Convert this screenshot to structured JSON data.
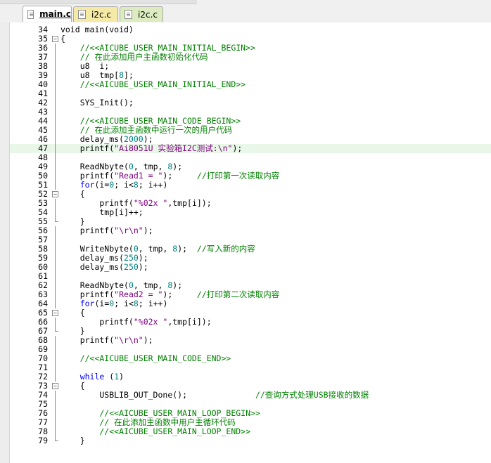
{
  "tabs": [
    {
      "label": "main.c",
      "active": true,
      "color": "#ffffff"
    },
    {
      "label": "i2c.c",
      "active": false,
      "color": "#f5e9a6"
    },
    {
      "label": "i2c.c",
      "active": false,
      "color": "#dcecc0"
    }
  ],
  "editor": {
    "current_line": 47,
    "lines": [
      {
        "n": 34,
        "fold": "none",
        "segs": [
          {
            "t": "void main(void)",
            "c": "fn"
          }
        ]
      },
      {
        "n": 35,
        "fold": "box",
        "segs": [
          {
            "t": "{",
            "c": "fn"
          }
        ]
      },
      {
        "n": 36,
        "fold": "v",
        "segs": [
          {
            "t": "    //<<AICUBE_USER_MAIN_INITIAL_BEGIN>>",
            "c": "com"
          }
        ]
      },
      {
        "n": 37,
        "fold": "v",
        "segs": [
          {
            "t": "    // 在此添加用户主函数初始化代码",
            "c": "com"
          }
        ]
      },
      {
        "n": 38,
        "fold": "v",
        "segs": [
          {
            "t": "    u8  i;",
            "c": "fn"
          }
        ]
      },
      {
        "n": 39,
        "fold": "v",
        "segs": [
          {
            "t": "    u8  tmp[",
            "c": "fn"
          },
          {
            "t": "8",
            "c": "num"
          },
          {
            "t": "];",
            "c": "fn"
          }
        ]
      },
      {
        "n": 40,
        "fold": "v",
        "segs": [
          {
            "t": "    //<<AICUBE_USER_MAIN_INITIAL_END>>",
            "c": "com"
          }
        ]
      },
      {
        "n": 41,
        "fold": "v",
        "segs": []
      },
      {
        "n": 42,
        "fold": "v",
        "segs": [
          {
            "t": "    SYS_Init();",
            "c": "fn"
          }
        ]
      },
      {
        "n": 43,
        "fold": "v",
        "segs": []
      },
      {
        "n": 44,
        "fold": "v",
        "segs": [
          {
            "t": "    //<<AICUBE_USER_MAIN_CODE_BEGIN>>",
            "c": "com"
          }
        ]
      },
      {
        "n": 45,
        "fold": "v",
        "segs": [
          {
            "t": "    // 在此添加主函数中运行一次的用户代码",
            "c": "com"
          }
        ]
      },
      {
        "n": 46,
        "fold": "v",
        "segs": [
          {
            "t": "    delay_ms(",
            "c": "fn"
          },
          {
            "t": "2000",
            "c": "num"
          },
          {
            "t": ");",
            "c": "fn"
          }
        ]
      },
      {
        "n": 47,
        "fold": "v",
        "segs": [
          {
            "t": "    printf(",
            "c": "fn"
          },
          {
            "t": "\"Ai8051U 实验箱I2C测试:\\n\"",
            "c": "str"
          },
          {
            "t": ");",
            "c": "fn"
          }
        ]
      },
      {
        "n": 48,
        "fold": "v",
        "segs": []
      },
      {
        "n": 49,
        "fold": "v",
        "segs": [
          {
            "t": "    ReadNbyte(",
            "c": "fn"
          },
          {
            "t": "0",
            "c": "num"
          },
          {
            "t": ", tmp, ",
            "c": "fn"
          },
          {
            "t": "8",
            "c": "num"
          },
          {
            "t": ");",
            "c": "fn"
          }
        ]
      },
      {
        "n": 50,
        "fold": "v",
        "segs": [
          {
            "t": "    printf(",
            "c": "fn"
          },
          {
            "t": "\"Read1 = \"",
            "c": "str"
          },
          {
            "t": ");     ",
            "c": "fn"
          },
          {
            "t": "//打印第一次读取内容",
            "c": "com"
          }
        ]
      },
      {
        "n": 51,
        "fold": "v",
        "segs": [
          {
            "t": "    ",
            "c": "fn"
          },
          {
            "t": "for",
            "c": "kw"
          },
          {
            "t": "(i=",
            "c": "fn"
          },
          {
            "t": "0",
            "c": "num"
          },
          {
            "t": "; i<",
            "c": "fn"
          },
          {
            "t": "8",
            "c": "num"
          },
          {
            "t": "; i++)",
            "c": "fn"
          }
        ]
      },
      {
        "n": 52,
        "fold": "box",
        "segs": [
          {
            "t": "    {",
            "c": "fn"
          }
        ]
      },
      {
        "n": 53,
        "fold": "v",
        "segs": [
          {
            "t": "        printf(",
            "c": "fn"
          },
          {
            "t": "\"%02x \"",
            "c": "str"
          },
          {
            "t": ",tmp[i]);",
            "c": "fn"
          }
        ]
      },
      {
        "n": 54,
        "fold": "v",
        "segs": [
          {
            "t": "        tmp[i]++;",
            "c": "fn"
          }
        ]
      },
      {
        "n": 55,
        "fold": "end",
        "segs": [
          {
            "t": "    }",
            "c": "fn"
          }
        ]
      },
      {
        "n": 56,
        "fold": "v",
        "segs": [
          {
            "t": "    printf(",
            "c": "fn"
          },
          {
            "t": "\"\\r\\n\"",
            "c": "str"
          },
          {
            "t": ");",
            "c": "fn"
          }
        ]
      },
      {
        "n": 57,
        "fold": "v",
        "segs": []
      },
      {
        "n": 58,
        "fold": "v",
        "segs": [
          {
            "t": "    WriteNbyte(",
            "c": "fn"
          },
          {
            "t": "0",
            "c": "num"
          },
          {
            "t": ", tmp, ",
            "c": "fn"
          },
          {
            "t": "8",
            "c": "num"
          },
          {
            "t": ");  ",
            "c": "fn"
          },
          {
            "t": "//写入新的内容",
            "c": "com"
          }
        ]
      },
      {
        "n": 59,
        "fold": "v",
        "segs": [
          {
            "t": "    delay_ms(",
            "c": "fn"
          },
          {
            "t": "250",
            "c": "num"
          },
          {
            "t": ");",
            "c": "fn"
          }
        ]
      },
      {
        "n": 60,
        "fold": "v",
        "segs": [
          {
            "t": "    delay_ms(",
            "c": "fn"
          },
          {
            "t": "250",
            "c": "num"
          },
          {
            "t": ");",
            "c": "fn"
          }
        ]
      },
      {
        "n": 61,
        "fold": "v",
        "segs": []
      },
      {
        "n": 62,
        "fold": "v",
        "segs": [
          {
            "t": "    ReadNbyte(",
            "c": "fn"
          },
          {
            "t": "0",
            "c": "num"
          },
          {
            "t": ", tmp, ",
            "c": "fn"
          },
          {
            "t": "8",
            "c": "num"
          },
          {
            "t": ");",
            "c": "fn"
          }
        ]
      },
      {
        "n": 63,
        "fold": "v",
        "segs": [
          {
            "t": "    printf(",
            "c": "fn"
          },
          {
            "t": "\"Read2 = \"",
            "c": "str"
          },
          {
            "t": ");     ",
            "c": "fn"
          },
          {
            "t": "//打印第二次读取内容",
            "c": "com"
          }
        ]
      },
      {
        "n": 64,
        "fold": "v",
        "segs": [
          {
            "t": "    ",
            "c": "fn"
          },
          {
            "t": "for",
            "c": "kw"
          },
          {
            "t": "(i=",
            "c": "fn"
          },
          {
            "t": "0",
            "c": "num"
          },
          {
            "t": "; i<",
            "c": "fn"
          },
          {
            "t": "8",
            "c": "num"
          },
          {
            "t": "; i++)",
            "c": "fn"
          }
        ]
      },
      {
        "n": 65,
        "fold": "box",
        "segs": [
          {
            "t": "    {",
            "c": "fn"
          }
        ]
      },
      {
        "n": 66,
        "fold": "v",
        "segs": [
          {
            "t": "        printf(",
            "c": "fn"
          },
          {
            "t": "\"%02x \"",
            "c": "str"
          },
          {
            "t": ",tmp[i]);",
            "c": "fn"
          }
        ]
      },
      {
        "n": 67,
        "fold": "end",
        "segs": [
          {
            "t": "    }",
            "c": "fn"
          }
        ]
      },
      {
        "n": 68,
        "fold": "v",
        "segs": [
          {
            "t": "    printf(",
            "c": "fn"
          },
          {
            "t": "\"\\r\\n\"",
            "c": "str"
          },
          {
            "t": ");",
            "c": "fn"
          }
        ]
      },
      {
        "n": 69,
        "fold": "v",
        "segs": []
      },
      {
        "n": 70,
        "fold": "v",
        "segs": [
          {
            "t": "    //<<AICUBE_USER_MAIN_CODE_END>>",
            "c": "com"
          }
        ]
      },
      {
        "n": 71,
        "fold": "v",
        "segs": []
      },
      {
        "n": 72,
        "fold": "v",
        "segs": [
          {
            "t": "    ",
            "c": "fn"
          },
          {
            "t": "while",
            "c": "kw"
          },
          {
            "t": " (",
            "c": "fn"
          },
          {
            "t": "1",
            "c": "num"
          },
          {
            "t": ")",
            "c": "fn"
          }
        ]
      },
      {
        "n": 73,
        "fold": "box",
        "segs": [
          {
            "t": "    {",
            "c": "fn"
          }
        ]
      },
      {
        "n": 74,
        "fold": "v",
        "segs": [
          {
            "t": "        USBLIB_OUT_Done();              ",
            "c": "fn"
          },
          {
            "t": "//查询方式处理USB接收的数据",
            "c": "com"
          }
        ]
      },
      {
        "n": 75,
        "fold": "v",
        "segs": []
      },
      {
        "n": 76,
        "fold": "v",
        "segs": [
          {
            "t": "        //<<AICUBE_USER_MAIN_LOOP_BEGIN>>",
            "c": "com"
          }
        ]
      },
      {
        "n": 77,
        "fold": "v",
        "segs": [
          {
            "t": "        // 在此添加主函数中用户主循环代码",
            "c": "com"
          }
        ]
      },
      {
        "n": 78,
        "fold": "v",
        "segs": [
          {
            "t": "        //<<AICUBE_USER_MAIN_LOOP_END>>",
            "c": "com"
          }
        ]
      },
      {
        "n": 79,
        "fold": "end",
        "segs": [
          {
            "t": "    }",
            "c": "fn"
          }
        ]
      }
    ]
  }
}
